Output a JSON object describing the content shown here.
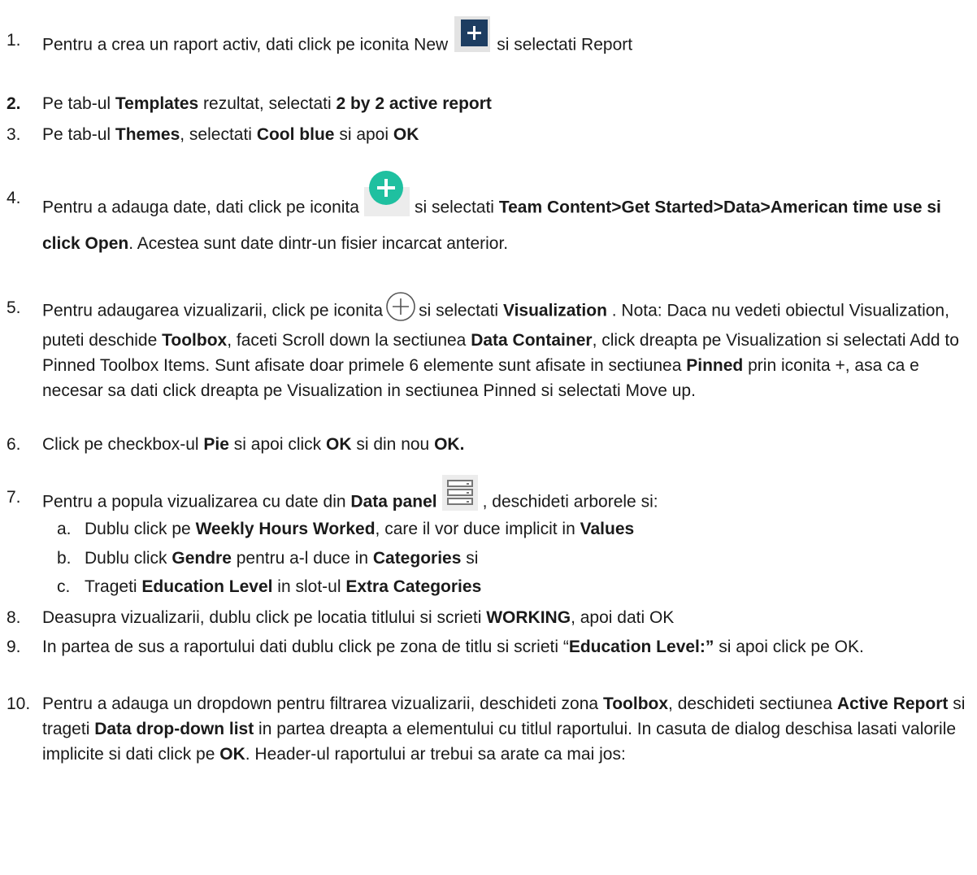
{
  "steps": [
    {
      "num": "1.",
      "parts": [
        "Pentru a crea un raport activ, dati click pe iconita New",
        "si selectati Report"
      ]
    },
    {
      "num": "2.",
      "parts": [
        "Pe tab-ul ",
        "Templates",
        " rezultat, selectati ",
        "2 by 2 active report"
      ]
    },
    {
      "num": "3.",
      "parts": [
        "Pe tab-ul ",
        "Themes",
        ", selectati ",
        "Cool blue",
        " si apoi ",
        "OK"
      ]
    },
    {
      "num": "4.",
      "parts": [
        "Pentru a adauga date, dati click pe iconita",
        "si selectati ",
        "Team Content>Get Started>Data>American time use si click Open",
        ". Acestea sunt date dintr-un fisier incarcat anterior."
      ]
    },
    {
      "num": "5.",
      "parts": [
        "Pentru adaugarea vizualizarii, click pe iconita",
        "si selectati ",
        "Visualization",
        " . Nota: Daca nu vedeti obiectul Visualization, puteti deschide ",
        "Toolbox",
        ", faceti Scroll down la sectiunea ",
        "Data Container",
        ", click dreapta pe Visualization si selectati Add to Pinned Toolbox Items. Sunt afisate doar primele 6 elemente sunt afisate in sectiunea  ",
        "Pinned",
        " prin iconita +, asa ca e necesar sa dati click dreapta pe Visualization in sectiunea Pinned si selectati Move up."
      ]
    },
    {
      "num": "6.",
      "parts": [
        "Click pe checkbox-ul ",
        "Pie",
        " si apoi click ",
        "OK",
        " si din nou ",
        "OK."
      ]
    },
    {
      "num": "7.",
      "parts": [
        "Pentru a popula vizualizarea cu date din ",
        "Data panel",
        ", deschideti arborele si:"
      ]
    },
    {
      "num": "8.",
      "parts": [
        "Deasupra vizualizarii, dublu click pe locatia titlului si scrieti ",
        "WORKING",
        ", apoi dati OK"
      ]
    },
    {
      "num": "9.",
      "parts": [
        "In partea de sus a raportului dati dublu click pe zona de titlu si scrieti “",
        "Education Level:”",
        " si apoi click pe OK."
      ]
    },
    {
      "num": "10.",
      "parts": [
        "Pentru a adauga un dropdown pentru filtrarea vizualizarii, deschideti zona ",
        "Toolbox",
        ", deschideti sectiunea ",
        "Active Report",
        " si trageti ",
        "Data drop-down list",
        " in partea dreapta a elementului cu titlul raportului. In casuta de dialog deschisa lasati valorile implicite si dati click pe ",
        "OK",
        ". Header-ul raportului ar trebui sa arate ca mai jos:"
      ]
    }
  ],
  "substeps": [
    {
      "num": "a.",
      "parts": [
        "Dublu click pe ",
        "Weekly Hours Worked",
        ", care il vor duce implicit in ",
        "Values"
      ]
    },
    {
      "num": "b.",
      "parts": [
        "Dublu click ",
        "Gendre",
        " pentru a-l duce in ",
        "Categories",
        " si"
      ]
    },
    {
      "num": "c.",
      "parts": [
        "Trageti ",
        "Education Level",
        " in slot-ul  ",
        "Extra Categories"
      ]
    }
  ],
  "icons": {
    "new": "new-plus-square-icon",
    "add_data": "add-data-plus-circle-icon",
    "add": "add-plus-circle-outline-icon",
    "data_panel": "data-panel-icon"
  },
  "colors": {
    "new_icon": "#1d3d61",
    "add_data_icon": "#1fc0a0",
    "text": "#1a1a1a"
  }
}
